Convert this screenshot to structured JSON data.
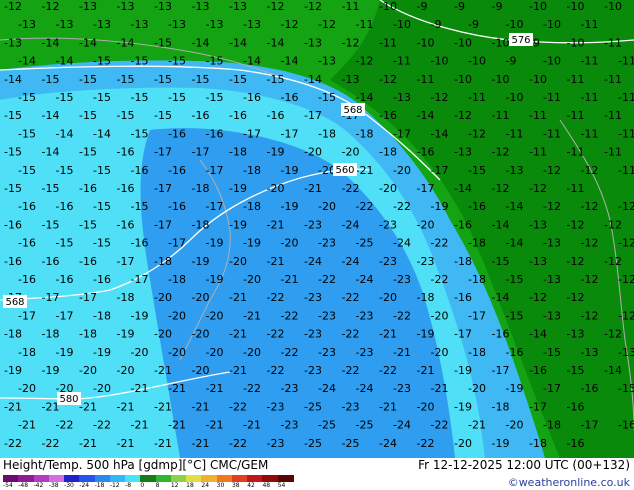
{
  "map": {
    "colors": {
      "green": "#0a8a0a",
      "light_green": "#13a313",
      "pale_green": "#2fb52f",
      "blue": "#2f9ef0",
      "light_blue": "#40b8f4",
      "cyan": "#4fe0f8",
      "coast": "#b0b0b0",
      "contour": "#ffffff"
    },
    "contours": [
      "576",
      "568",
      "560",
      "568",
      "580"
    ],
    "rows": [
      [
        "-12",
        "-12",
        "-13",
        "-13",
        "-13",
        "-13",
        "-13",
        "-12",
        "-12",
        "-11",
        "-10",
        "-9",
        "-9",
        "-9",
        "-10",
        "-10",
        "-10"
      ],
      [
        "-13",
        "-13",
        "-13",
        "-13",
        "-13",
        "-13",
        "-13",
        "-12",
        "-12",
        "-11",
        "-10",
        "-9",
        "-9",
        "-10",
        "-10",
        "-11"
      ],
      [
        "-13",
        "-14",
        "-14",
        "-14",
        "-15",
        "-14",
        "-14",
        "-14",
        "-13",
        "-12",
        "-11",
        "-10",
        "-10",
        "-10",
        "-9",
        "-10",
        "-11"
      ],
      [
        "-14",
        "-14",
        "-15",
        "-15",
        "-15",
        "-15",
        "-14",
        "-14",
        "-13",
        "-12",
        "-11",
        "-10",
        "-10",
        "-9",
        "-10",
        "-11",
        "-11"
      ],
      [
        "-14",
        "-15",
        "-15",
        "-15",
        "-15",
        "-15",
        "-15",
        "-15",
        "-14",
        "-13",
        "-12",
        "-11",
        "-10",
        "-10",
        "-10",
        "-11",
        "-11"
      ],
      [
        "-15",
        "-15",
        "-15",
        "-15",
        "-15",
        "-15",
        "-16",
        "-16",
        "-15",
        "-14",
        "-13",
        "-12",
        "-11",
        "-10",
        "-11",
        "-11",
        "-11"
      ],
      [
        "-15",
        "-14",
        "-15",
        "-15",
        "-15",
        "-16",
        "-16",
        "-16",
        "-17",
        "-17",
        "-16",
        "-14",
        "-12",
        "-11",
        "-11",
        "-11",
        "-11"
      ],
      [
        "-15",
        "-14",
        "-14",
        "-15",
        "-16",
        "-16",
        "-17",
        "-17",
        "-18",
        "-18",
        "-17",
        "-14",
        "-12",
        "-11",
        "-11",
        "-11",
        "-11"
      ],
      [
        "-15",
        "-14",
        "-15",
        "-16",
        "-17",
        "-17",
        "-18",
        "-19",
        "-20",
        "-20",
        "-18",
        "-16",
        "-13",
        "-12",
        "-11",
        "-11",
        "-11"
      ],
      [
        "-15",
        "-15",
        "-15",
        "-16",
        "-16",
        "-17",
        "-18",
        "-19",
        "-20",
        "-21",
        "-20",
        "-17",
        "-15",
        "-13",
        "-12",
        "-12",
        "-11"
      ],
      [
        "-15",
        "-15",
        "-16",
        "-16",
        "-17",
        "-18",
        "-19",
        "-20",
        "-21",
        "-22",
        "-20",
        "-17",
        "-14",
        "-12",
        "-12",
        "-11"
      ],
      [
        "-16",
        "-16",
        "-15",
        "-15",
        "-16",
        "-17",
        "-18",
        "-19",
        "-20",
        "-22",
        "-22",
        "-19",
        "-16",
        "-14",
        "-12",
        "-12",
        "-12"
      ],
      [
        "-16",
        "-15",
        "-15",
        "-16",
        "-17",
        "-18",
        "-19",
        "-21",
        "-23",
        "-24",
        "-23",
        "-20",
        "-16",
        "-14",
        "-13",
        "-12",
        "-12"
      ],
      [
        "-16",
        "-15",
        "-15",
        "-16",
        "-17",
        "-19",
        "-19",
        "-20",
        "-23",
        "-25",
        "-24",
        "-22",
        "-18",
        "-14",
        "-13",
        "-12",
        "-12"
      ],
      [
        "-16",
        "-16",
        "-16",
        "-17",
        "-18",
        "-19",
        "-20",
        "-21",
        "-24",
        "-24",
        "-23",
        "-23",
        "-18",
        "-15",
        "-13",
        "-12",
        "-12"
      ],
      [
        "-16",
        "-16",
        "-16",
        "-17",
        "-18",
        "-19",
        "-20",
        "-21",
        "-22",
        "-24",
        "-23",
        "-22",
        "-18",
        "-15",
        "-13",
        "-12",
        "-12"
      ],
      [
        "-17",
        "-17",
        "-17",
        "-18",
        "-20",
        "-20",
        "-21",
        "-22",
        "-23",
        "-22",
        "-20",
        "-18",
        "-16",
        "-14",
        "-12",
        "-12"
      ],
      [
        "-17",
        "-17",
        "-18",
        "-19",
        "-20",
        "-20",
        "-21",
        "-22",
        "-23",
        "-23",
        "-22",
        "-20",
        "-17",
        "-15",
        "-13",
        "-12",
        "-12"
      ],
      [
        "-18",
        "-18",
        "-18",
        "-19",
        "-20",
        "-20",
        "-21",
        "-22",
        "-23",
        "-22",
        "-21",
        "-19",
        "-17",
        "-16",
        "-14",
        "-13",
        "-12"
      ],
      [
        "-18",
        "-19",
        "-19",
        "-20",
        "-20",
        "-20",
        "-20",
        "-22",
        "-23",
        "-23",
        "-21",
        "-20",
        "-18",
        "-16",
        "-15",
        "-13",
        "-13"
      ],
      [
        "-19",
        "-19",
        "-20",
        "-20",
        "-21",
        "-20",
        "-21",
        "-22",
        "-23",
        "-22",
        "-22",
        "-21",
        "-19",
        "-17",
        "-16",
        "-15",
        "-14"
      ],
      [
        "-20",
        "-20",
        "-20",
        "-21",
        "-21",
        "-21",
        "-22",
        "-23",
        "-24",
        "-24",
        "-23",
        "-21",
        "-20",
        "-19",
        "-17",
        "-16",
        "-15"
      ],
      [
        "-21",
        "-21",
        "-21",
        "-21",
        "-21",
        "-21",
        "-22",
        "-23",
        "-25",
        "-23",
        "-21",
        "-20",
        "-19",
        "-18",
        "-17",
        "-16"
      ],
      [
        "-21",
        "-22",
        "-22",
        "-21",
        "-21",
        "-21",
        "-21",
        "-23",
        "-25",
        "-25",
        "-24",
        "-22",
        "-21",
        "-20",
        "-18",
        "-17",
        "-16"
      ],
      [
        "-22",
        "-22",
        "-21",
        "-21",
        "-21",
        "-21",
        "-22",
        "-23",
        "-25",
        "-25",
        "-24",
        "-22",
        "-20",
        "-19",
        "-18",
        "-16"
      ]
    ]
  },
  "footer": {
    "title": "Height/Temp. 500 hPa [gdmp][°C] CMC/GEM",
    "datetime": "Fr 12-12-2025 12:00 UTC (00+132)",
    "credit": "©weatheronline.co.uk",
    "scale": {
      "labels": [
        "-54",
        "-48",
        "-42",
        "-38",
        "-30",
        "-24",
        "-18",
        "-12",
        "-8",
        "0",
        "8",
        "12",
        "18",
        "24",
        "30",
        "38",
        "42",
        "48",
        "54"
      ],
      "colors": [
        "#6b0b6e",
        "#8e1c95",
        "#b43cc0",
        "#d36fe0",
        "#2222cc",
        "#2255ee",
        "#2b88f2",
        "#33b8f6",
        "#44e4fb",
        "#1a7a1a",
        "#2fb52f",
        "#8ad24a",
        "#e0e040",
        "#f0b030",
        "#f07820",
        "#e04020",
        "#c01818",
        "#900c0c",
        "#5a0505"
      ]
    }
  }
}
